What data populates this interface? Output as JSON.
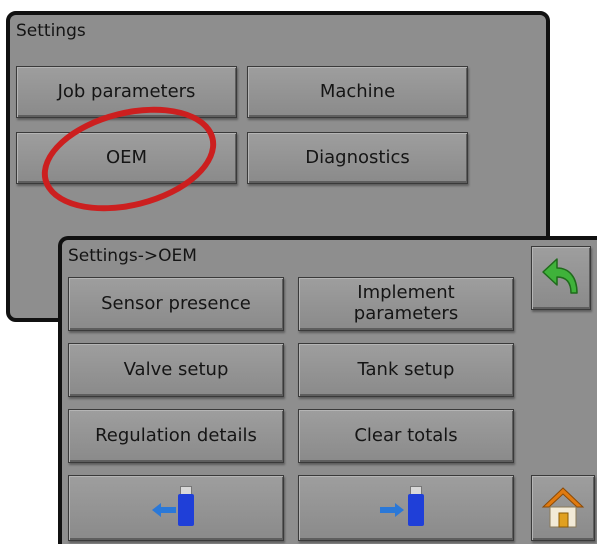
{
  "settings": {
    "title": "Settings",
    "buttons": {
      "job_parameters": "Job parameters",
      "machine": "Machine",
      "oem": "OEM",
      "diagnostics": "Diagnostics"
    },
    "highlight_color": "#cc1f1f"
  },
  "oem_panel": {
    "title": "Settings->OEM",
    "buttons": {
      "sensor_presence": "Sensor presence",
      "implement_parameters_line1": "Implement",
      "implement_parameters_line2": "parameters",
      "valve_setup": "Valve setup",
      "tank_setup": "Tank setup",
      "regulation_details": "Regulation details",
      "clear_totals": "Clear totals"
    },
    "icons": {
      "back": "back-arrow-icon",
      "home": "home-icon",
      "usb_export": "usb-export-icon",
      "usb_import": "usb-import-icon"
    },
    "colors": {
      "back_arrow": "#3fb23a",
      "usb": "#1f3fd8",
      "arrow": "#2a78d8",
      "home_roof": "#e07a10"
    }
  }
}
